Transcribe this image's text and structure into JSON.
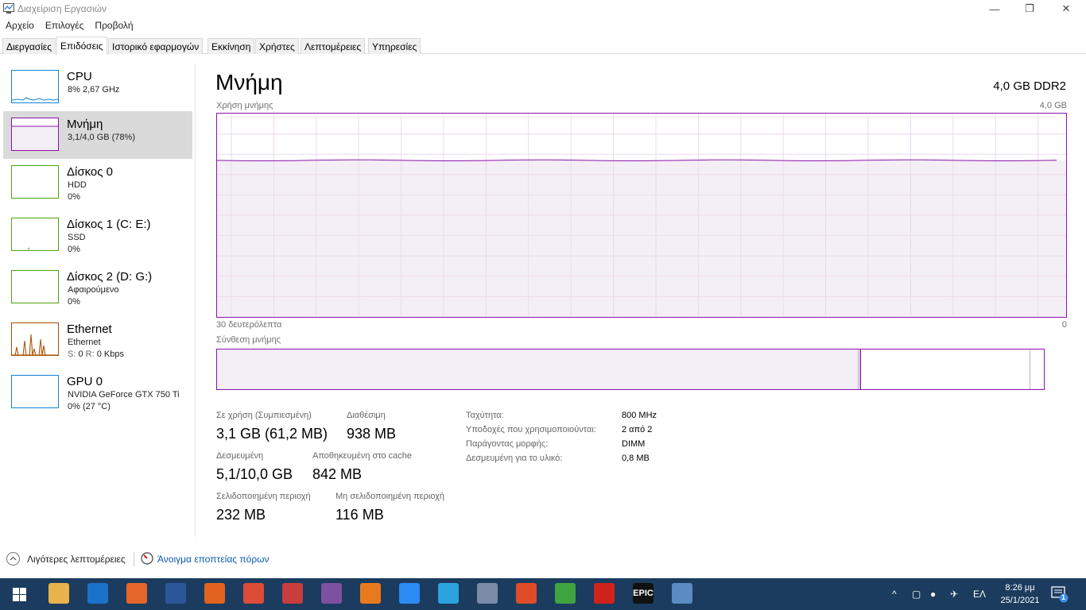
{
  "window": {
    "title": "Διαχείριση Εργασιών",
    "minimize": "—",
    "maximize": "❐",
    "close": "✕"
  },
  "menu": [
    "Αρχείο",
    "Επιλογές",
    "Προβολή"
  ],
  "tabs": [
    {
      "label": "Διεργασίες",
      "active": false
    },
    {
      "label": "Επιδόσεις",
      "active": true
    },
    {
      "label": "Ιστορικό εφαρμογών",
      "active": false
    },
    {
      "label": "Εκκίνηση",
      "active": false
    },
    {
      "label": "Χρήστες",
      "active": false
    },
    {
      "label": "Λεπτομέρειες",
      "active": false
    },
    {
      "label": "Υπηρεσίες",
      "active": false
    }
  ],
  "resources": [
    {
      "name": "CPU",
      "line1": "8% 2,67 GHz",
      "line2": "",
      "color": "#1183d7",
      "selected": false
    },
    {
      "name": "Μνήμη",
      "line1": "3,1/4,0 GB (78%)",
      "line2": "",
      "color": "#8b12ae",
      "selected": true
    },
    {
      "name": "Δίσκος 0",
      "line1": "HDD",
      "line2": "0%",
      "color": "#4da60c",
      "selected": false
    },
    {
      "name": "Δίσκος 1 (C: E:)",
      "line1": "SSD",
      "line2": "0%",
      "color": "#4da60c",
      "selected": false
    },
    {
      "name": "Δίσκος 2 (D: G:)",
      "line1": "Αφαιρούμενο",
      "line2": "0%",
      "color": "#4da60c",
      "selected": false
    },
    {
      "name": "Ethernet",
      "line1": "Ethernet",
      "line2_label_s": "S:",
      "line2_val_s": "0",
      "line2_label_r": "R:",
      "line2_val_r": "0 Kbps",
      "color": "#a74f01",
      "selected": false
    },
    {
      "name": "GPU 0",
      "line1": "NVIDIA GeForce GTX 750 Ti",
      "line2": "0% (27 °C)",
      "color": "#1183d7",
      "selected": false
    }
  ],
  "main": {
    "title": "Μνήμη",
    "spec": "4,0 GB DDR2",
    "usage_label": "Χρήση μνήμης",
    "usage_max": "4,0 GB",
    "axis_left": "30 δευτερόλεπτα",
    "axis_right": "0",
    "composition_label": "Σύνθεση μνήμης",
    "usage_level": 0.77,
    "composition": {
      "in_use": 0.775,
      "modified": 0.003,
      "standby": 0.205,
      "free": 0.017
    }
  },
  "stats": {
    "in_use_label": "Σε χρήση (Συμπιεσμένη)",
    "in_use_value": "3,1 GB (61,2 MB)",
    "available_label": "Διαθέσιμη",
    "available_value": "938 MB",
    "committed_label": "Δεσμευμένη",
    "committed_value": "5,1/10,0 GB",
    "cached_label": "Αποθηκευμένη στο cache",
    "cached_value": "842 MB",
    "paged_label": "Σελιδοποιημένη περιοχή",
    "paged_value": "232 MB",
    "nonpaged_label": "Μη σελιδοποιημένη περιοχή",
    "nonpaged_value": "116 MB"
  },
  "details": [
    {
      "label": "Ταχύτητα:",
      "value": "800 MHz"
    },
    {
      "label": "Υποδοχές που χρησιμοποιούνται:",
      "value": "2 από 2"
    },
    {
      "label": "Παράγοντας μορφής:",
      "value": "DIMM"
    },
    {
      "label": "Δεσμευμένη για το υλικό:",
      "value": "0,8 MB"
    }
  ],
  "footer": {
    "fewer_details": "Λιγότερες λεπτομέρειες",
    "open_monitor": "Άνοιγμα εποπτείας πόρων"
  },
  "taskbar": {
    "apps": [
      {
        "icon": "file-explorer-icon",
        "color": "#e8b34a"
      },
      {
        "icon": "mail-icon",
        "color": "#1a73c8"
      },
      {
        "icon": "firefox-icon",
        "color": "#e5662a"
      },
      {
        "icon": "word-icon",
        "color": "#2b579a"
      },
      {
        "icon": "orange-app-icon",
        "color": "#e2621f"
      },
      {
        "icon": "chrome-icon",
        "color": "#dd4b39"
      },
      {
        "icon": "pin-tool-icon",
        "color": "#c83d3d"
      },
      {
        "icon": "viber-icon",
        "color": "#7d51a0"
      },
      {
        "icon": "camera-app-icon",
        "color": "#e87a1e"
      },
      {
        "icon": "messenger-icon",
        "color": "#2c8af5"
      },
      {
        "icon": "telegram-icon",
        "color": "#2aa3df"
      },
      {
        "icon": "network-tool-icon",
        "color": "#7a8ca8"
      },
      {
        "icon": "anydesk-icon",
        "color": "#e04b2a"
      },
      {
        "icon": "android-emulator-icon",
        "color": "#3fa33f"
      },
      {
        "icon": "acrobat-icon",
        "color": "#d0231c"
      },
      {
        "icon": "epic-games-icon",
        "color": "#111111",
        "text": "EPIC"
      },
      {
        "icon": "task-manager-icon",
        "color": "#5a8bc2"
      }
    ],
    "language": "ΕΛ",
    "time": "8:26 μμ",
    "date": "25/1/2021",
    "notifications": "1"
  }
}
